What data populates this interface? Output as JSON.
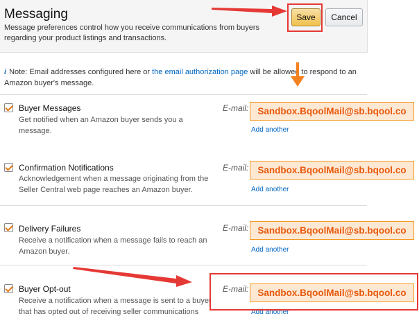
{
  "header": {
    "title": "Messaging",
    "description": "Message preferences control how you receive communications from buyers regarding your product listings and transactions.",
    "save_label": "Save",
    "cancel_label": "Cancel"
  },
  "note": {
    "icon": "i",
    "prefix": "Note: Email addresses configured here or ",
    "link": "the email authorization page",
    "suffix": " will be allowed to respond to an Amazon buyer's message."
  },
  "rows": [
    {
      "title": "Buyer Messages",
      "description": "Get notified when an Amazon buyer sends you a message.",
      "email_label": "E-mail:",
      "email": "Sandbox.BqoolMail@sb.bqool.co",
      "add_another": "Add another",
      "checked": true
    },
    {
      "title": "Confirmation Notifications",
      "description": "Acknowledgement when a message originating from the Seller Central web page reaches an Amazon buyer.",
      "email_label": "E-mail:",
      "email": "Sandbox.BqoolMail@sb.bqool.co",
      "add_another": "Add another",
      "checked": true
    },
    {
      "title": "Delivery Failures",
      "description": "Receive a notification when a message fails to reach an Amazon buyer.",
      "email_label": "E-mail:",
      "email": "Sandbox.BqoolMail@sb.bqool.co",
      "add_another": "Add another",
      "checked": true
    },
    {
      "title": "Buyer Opt-out",
      "description": "Receive a notification when a message is sent to a buyer that has opted out of receiving seller communications",
      "email_label": "E-mail:",
      "email": "Sandbox.BqoolMail@sb.bqool.co",
      "add_another": "Add another",
      "checked": true
    }
  ],
  "colors": {
    "accent": "#e47911",
    "annotation_red": "#e53935",
    "annotation_orange": "#f58220",
    "link": "#0066c0"
  }
}
